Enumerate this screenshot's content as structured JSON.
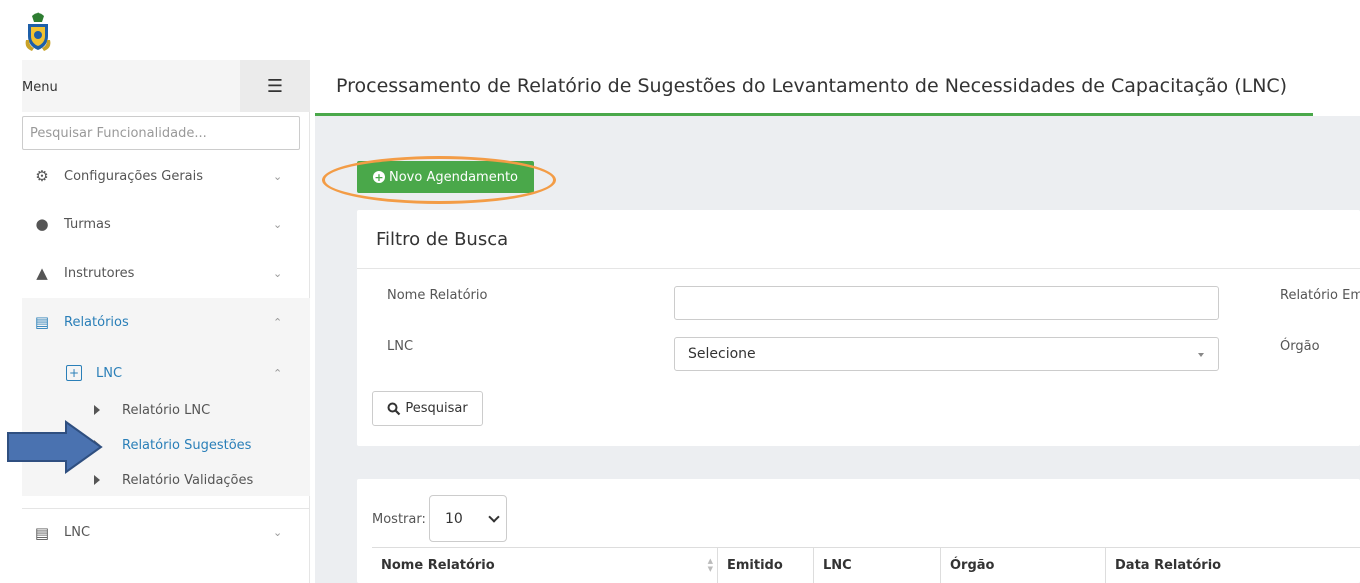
{
  "sidebar": {
    "menu_label": "Menu",
    "search_placeholder": "Pesquisar Funcionalidade...",
    "items": [
      {
        "label": "Configurações Gerais",
        "icon": "gears-icon"
      },
      {
        "label": "Turmas",
        "icon": "users-icon"
      },
      {
        "label": "Instrutores",
        "icon": "graduation-cap-icon"
      },
      {
        "label": "Relatórios",
        "icon": "file-icon"
      },
      {
        "label": "LNC",
        "icon": "server-icon"
      }
    ],
    "submenu": {
      "label": "LNC",
      "children": [
        {
          "label": "Relatório LNC"
        },
        {
          "label": "Relatório Sugestões"
        },
        {
          "label": "Relatório Validações"
        }
      ]
    }
  },
  "header": {
    "title": "Processamento de Relatório de Sugestões do Levantamento de Necessidades de Capacitação (LNC)"
  },
  "actions": {
    "new_schedule_label": "Novo Agendamento"
  },
  "filter": {
    "title": "Filtro de Busca",
    "name_label": "Nome Relatório",
    "name_value": "",
    "lnc_label": "LNC",
    "lnc_selected": "Selecione",
    "emitted_label": "Relatório Em",
    "org_label": "Órgão",
    "search_button": "Pesquisar"
  },
  "table": {
    "show_label": "Mostrar:",
    "page_size": "10",
    "columns": [
      "Nome Relatório",
      "Emitido",
      "LNC",
      "Órgão",
      "Data Relatório"
    ]
  },
  "colors": {
    "primary_green": "#4aa84a",
    "link_blue": "#2a7fb8",
    "highlight_orange": "#f39c46",
    "arrow_blue": "#4a72b0"
  }
}
